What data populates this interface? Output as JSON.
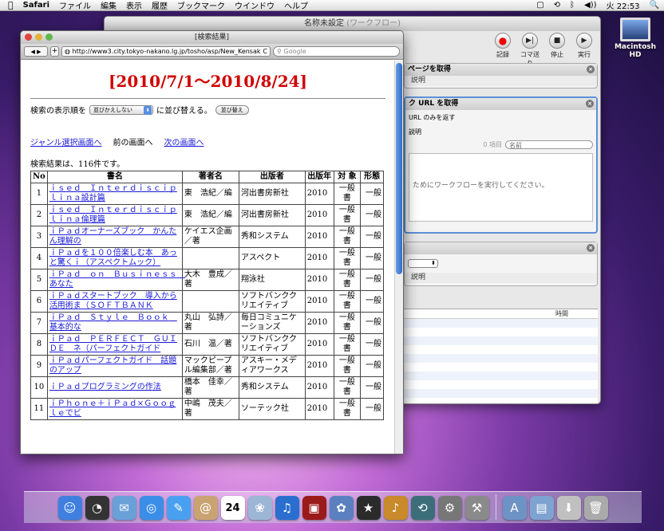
{
  "menubar": {
    "apple": "",
    "app": "Safari",
    "items": [
      "ファイル",
      "編集",
      "表示",
      "履歴",
      "ブックマーク",
      "ウインドウ",
      "ヘルプ"
    ],
    "clock": "火 22:53"
  },
  "desktop": {
    "hd_label": "Macintosh HD"
  },
  "automator": {
    "title": "名称未設定",
    "subtitle": "(ワークフロー)",
    "tools": [
      "記録",
      "コマ送り",
      "停止",
      "実行"
    ],
    "action1": {
      "title": "ページを取得",
      "desc": "説明"
    },
    "action2": {
      "title": "ク URL を取得",
      "line": "URL のみを返す",
      "desc": "説明",
      "search_placeholder": "名前",
      "count": "0 項目",
      "message": "ためにワークフローを実行してください。"
    },
    "action3": {
      "desc": "説明"
    },
    "list_header": "時間"
  },
  "safari": {
    "title": "[検索結果]",
    "url": "http://www3.city.tokyo-nakano.lg.jp/tosho/asp/New_Kensak",
    "search_placeholder": "Google",
    "nav_back": "◀",
    "nav_fwd": "▶",
    "plus": "+",
    "reload": "C"
  },
  "page": {
    "heading": "[2010/7/1〜2010/8/24]",
    "sort_label": "検索の表示順を",
    "sort_value": "並びかえしない",
    "sort_suffix": "に並び替える。",
    "sort_button": "並び替え",
    "link_genre": "ジャンル選択画面へ",
    "prev_text": "前の画面へ",
    "link_next": "次の画面へ",
    "result_text": "検索結果は、116件です。",
    "columns": [
      "No",
      "書名",
      "著者名",
      "出版者",
      "出版年",
      "対 象",
      "形態"
    ],
    "rows": [
      [
        "1",
        "ｉｓｅｄ　Ｉｎｔｅｒｄｉｓｃｉｐｌｉｎａ設計篇",
        "東　浩紀／編",
        "河出書房新社",
        "2010",
        "一般書",
        "一般"
      ],
      [
        "2",
        "ｉｓｅｄ　Ｉｎｔｅｒｄｉｓｃｉｐｌｉｎａ倫理篇",
        "東　浩紀／編",
        "河出書房新社",
        "2010",
        "一般書",
        "一般"
      ],
      [
        "3",
        "ｉＰａｄオーナーズブック　かんたん理解の",
        "ケイエス企画／著",
        "秀和システム",
        "2010",
        "一般書",
        "一般"
      ],
      [
        "4",
        "ｉＰａｄを１００倍楽しむ本　あっと驚くｉ（アスペクトムック）",
        "",
        "アスペクト",
        "2010",
        "一般書",
        "一般"
      ],
      [
        "5",
        "ｉＰａｄ　ｏｎ　Ｂｕｓｉｎｅｓｓ　あなた",
        "大木　豊成／著",
        "翔泳社",
        "2010",
        "一般書",
        "一般"
      ],
      [
        "6",
        "ｉＰａｄスタートブック　導入から活用術ま（ＳＯＦＴＢＡＮＫ",
        "",
        "ソフトバンククリエイティブ",
        "2010",
        "一般書",
        "一般"
      ],
      [
        "7",
        "ｉＰａｄ　Ｓｔｙｌｅ　Ｂｏｏｋ　基本的な",
        "丸山　弘詩／著",
        "毎日コミュニケーションズ",
        "2010",
        "一般書",
        "一般"
      ],
      [
        "8",
        "ｉＰａｄ　ＰＥＲＦＥＣＴ　ＧＵＩＤＥ　ネ（パーフェクトガイド",
        "石川　温／著",
        "ソフトバンククリエイティブ",
        "2010",
        "一般書",
        "一般"
      ],
      [
        "9",
        "ｉＰａｄパーフェクトガイド　話題のアップ",
        "マックピープル編集部／著",
        "アスキー・メディアワークス",
        "2010",
        "一般書",
        "一般"
      ],
      [
        "10",
        "ｉＰａｄプログラミングの作法",
        "橋本　佳幸／著",
        "秀和システム",
        "2010",
        "一般書",
        "一般"
      ],
      [
        "11",
        "ｉＰｈｏｎｅ＋ｉＰａｄ×Ｇｏｏｇｌｅでビ",
        "中嶋　茂夫／著",
        "ソーテック社",
        "2010",
        "一般書",
        "一般"
      ]
    ]
  },
  "dock": {
    "icons": [
      "finder-icon",
      "dashboard-icon",
      "mail-icon",
      "safari-icon",
      "ichat-icon",
      "address-book-icon",
      "ical-icon",
      "preview-icon",
      "itunes-icon",
      "photo-booth-icon",
      "iphoto-icon",
      "imovie-icon",
      "garageband-icon",
      "time-machine-icon",
      "system-preferences-icon",
      "automator-icon",
      "applications-folder-icon",
      "documents-folder-icon",
      "downloads-icon",
      "trash-icon"
    ],
    "ical_date": "24"
  }
}
